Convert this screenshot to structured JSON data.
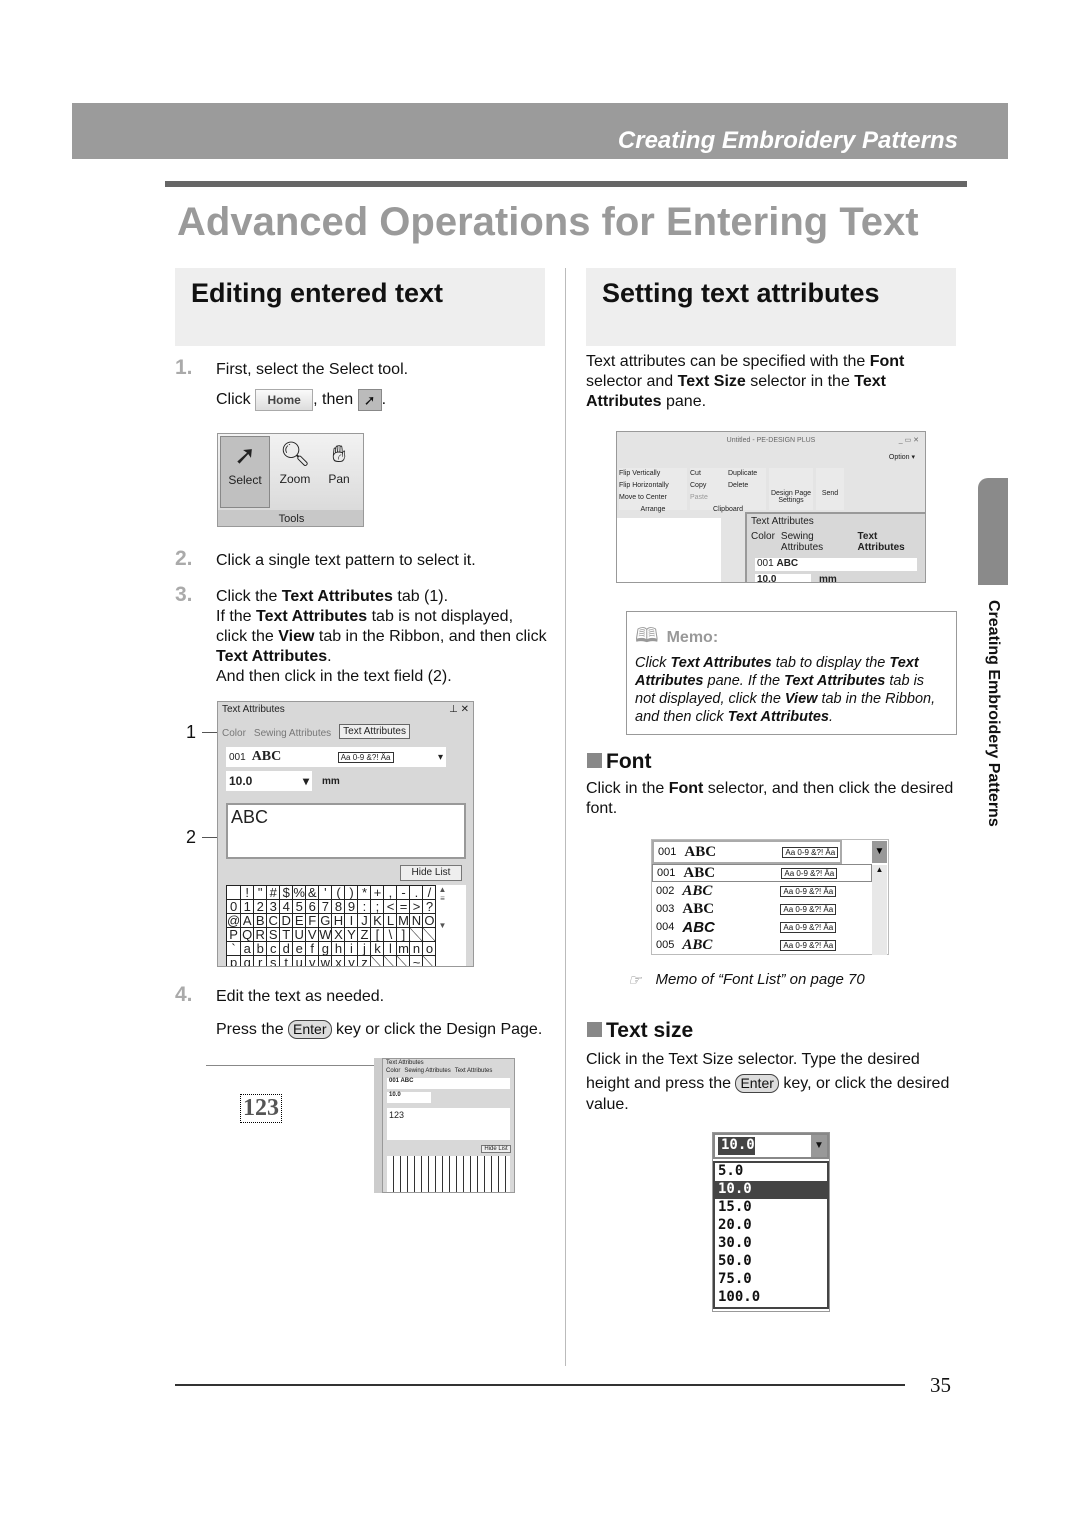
{
  "header": {
    "chapter": "Creating Embroidery Patterns"
  },
  "title": "Advanced Operations for Entering Text",
  "side_tab": "Creating Embroidery Patterns",
  "page_number": "35",
  "left": {
    "heading": "Editing entered text",
    "steps": [
      {
        "num": "1.",
        "line1": "First, select the Select tool.",
        "click": "Click",
        "home": "Home",
        "then": ", then",
        "period": "."
      },
      {
        "num": "2.",
        "text": "Click a single text pattern to select it."
      },
      {
        "num": "3.",
        "line1_a": "Click the ",
        "line1_b": "Text Attributes",
        "line1_c": " tab (1).",
        "line2_a": "If the ",
        "line2_b": "Text Attributes",
        "line2_c": " tab is not displayed,",
        "line3_a": "click the ",
        "line3_b": "View",
        "line3_c": " tab in the Ribbon, and then click",
        "line4": "Text Attributes",
        "line4_c": ".",
        "line5": "And then click in the text field (2)."
      },
      {
        "num": "4.",
        "text": "Edit the text as needed.",
        "press_a": "Press the ",
        "key": "Enter",
        "press_b": " key or click the Design Page."
      }
    ],
    "tools": {
      "select": "Select",
      "zoom": "Zoom",
      "pan": "Pan",
      "group": "Tools"
    },
    "callouts": [
      "1",
      "2"
    ],
    "panel": {
      "title": "Text Attributes",
      "tabs": [
        "Color",
        "Sewing Attributes",
        "Text Attributes"
      ],
      "font_num": "001",
      "font_sample": "ABC",
      "font_badges": "Aa 0-9 &?! Äa",
      "size": "10.0",
      "unit": "mm",
      "text_value": "ABC",
      "hide_list": "Hide List"
    },
    "char_grid": [
      [
        " ",
        "!",
        "\"",
        "#",
        "$",
        "%",
        "&",
        "'",
        "(",
        ")",
        "*",
        "+",
        ",",
        "-",
        ".",
        "/"
      ],
      [
        "0",
        "1",
        "2",
        "3",
        "4",
        "5",
        "6",
        "7",
        "8",
        "9",
        ":",
        ";",
        "<",
        "=",
        ">",
        "?"
      ],
      [
        "@",
        "A",
        "B",
        "C",
        "D",
        "E",
        "F",
        "G",
        "H",
        "I",
        "J",
        "K",
        "L",
        "M",
        "N",
        "O"
      ],
      [
        "P",
        "Q",
        "R",
        "S",
        "T",
        "U",
        "V",
        "W",
        "X",
        "Y",
        "Z",
        "[",
        "\\",
        "]",
        "",
        ""
      ],
      [
        "`",
        "a",
        "b",
        "c",
        "d",
        "e",
        "f",
        "g",
        "h",
        "i",
        "j",
        "k",
        "l",
        "m",
        "n",
        "o"
      ],
      [
        "p",
        "q",
        "r",
        "s",
        "t",
        "u",
        "v",
        "w",
        "x",
        "y",
        "z",
        "",
        "",
        "",
        "~",
        ""
      ]
    ],
    "result": {
      "design_text": "123",
      "text_value": "123"
    }
  },
  "right": {
    "heading": "Setting text attributes",
    "intro": [
      {
        "a": "Text attributes can be specified with the ",
        "b": "Font"
      },
      {
        "a": "selector and ",
        "b": "Text Size",
        "c": " selector in the ",
        "d": "Text"
      },
      {
        "b": "Attributes",
        "c": " pane."
      }
    ],
    "app": {
      "window_title": "Untitled - PE-DESIGN PLUS",
      "option": "Option",
      "arrange": [
        "Flip Vertically",
        "Flip Horizontally",
        "Move to Center"
      ],
      "arrange_group": "Arrange",
      "clipboard": [
        "Cut",
        "Duplicate",
        "Copy",
        "Delete",
        "Paste"
      ],
      "clipboard_group": "Clipboard",
      "design_page": "Design Page Settings",
      "send": "Send"
    },
    "memo": {
      "label": "Memo:",
      "lines": [
        {
          "a": "Click ",
          "b": "Text Attributes",
          "c": " tab to display the ",
          "d": "Text"
        },
        {
          "b": "Attributes",
          "c": " pane. If the ",
          "d": "Text Attributes",
          "e": " tab is"
        },
        {
          "a": "not displayed, click the ",
          "b": "View",
          "c": " tab in the Ribbon,"
        },
        {
          "a": "and then click ",
          "b": "Text Attributes",
          "c": "."
        }
      ]
    },
    "font": {
      "heading": "Font",
      "line1_a": "Click in the ",
      "line1_b": "Font",
      "line1_c": " selector, and then click the desired",
      "line2": "font.",
      "list": [
        {
          "num": "001",
          "sample": "ABC"
        },
        {
          "num": "002",
          "sample": "ABC"
        },
        {
          "num": "003",
          "sample": "ABC"
        },
        {
          "num": "004",
          "sample": "ABC"
        },
        {
          "num": "005",
          "sample": "ABC"
        }
      ],
      "badges": "Aa 0-9 &?! Äa",
      "reference": "Memo of “Font List” on page 70"
    },
    "text_size": {
      "heading": "Text size",
      "line1": "Click in the Text Size selector. Type the desired",
      "line2_a": "height and press the ",
      "key": "Enter",
      "line2_b": " key, or click the desired",
      "line3": "value.",
      "current": "10.0",
      "options": [
        "5.0",
        "10.0",
        "15.0",
        "20.0",
        "30.0",
        "50.0",
        "75.0",
        "100.0"
      ],
      "selected": "10.0"
    }
  }
}
